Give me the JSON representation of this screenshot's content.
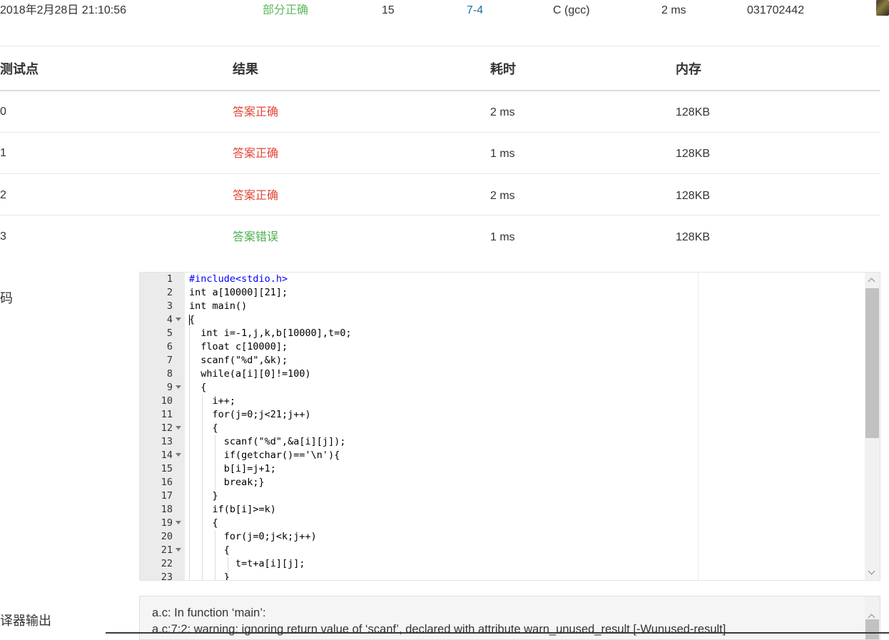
{
  "submission": {
    "time": "2018年2月28日 21:10:56",
    "status": "部分正确",
    "score": "15",
    "problem": "7-4",
    "compiler": "C (gcc)",
    "duration": "2 ms",
    "user": "031702442"
  },
  "test_table": {
    "headers": [
      "测试点",
      "结果",
      "耗时",
      "内存"
    ],
    "rows": [
      {
        "case": "0",
        "result": "答案正确",
        "time": "2 ms",
        "memory": "128KB"
      },
      {
        "case": "1",
        "result": "答案正确",
        "time": "1 ms",
        "memory": "128KB"
      },
      {
        "case": "2",
        "result": "答案正确",
        "time": "2 ms",
        "memory": "128KB"
      },
      {
        "case": "3",
        "result": "答案错误",
        "time": "1 ms",
        "memory": "128KB"
      }
    ]
  },
  "code_section": {
    "label": "码",
    "line_numbers": [
      "1",
      "2",
      "3",
      "4",
      "5",
      "6",
      "7",
      "8",
      "9",
      "10",
      "11",
      "12",
      "13",
      "14",
      "15",
      "16",
      "17",
      "18",
      "19",
      "20",
      "21",
      "22",
      "23"
    ],
    "lines": [
      "#include<stdio.h>",
      "int a[10000][21];",
      "int main()",
      "{",
      "  int i=-1,j,k,b[10000],t=0;",
      "  float c[10000];",
      "  scanf(\"%d\",&k);",
      "  while(a[i][0]!=100)",
      "  {",
      "    i++;",
      "    for(j=0;j<21;j++)",
      "    {",
      "      scanf(\"%d\",&a[i][j]);",
      "      if(getchar()=='\\n'){",
      "      b[i]=j+1;",
      "      break;}",
      "    }",
      "    if(b[i]>=k)",
      "    {",
      "      for(j=0;j<k;j++)",
      "      {",
      "        t=t+a[i][j];",
      "      }"
    ]
  },
  "compile_section": {
    "label": "译器输出",
    "lines": [
      "a.c: In function ‘main’:",
      "a.c:7:2: warning: ignoring return value of ‘scanf’, declared with attribute warn_unused_result [-Wunused-result]"
    ]
  },
  "colors": {
    "status_partial": "#5cb85c",
    "answer_correct": "#e0463a",
    "answer_wrong": "#4cae4c",
    "problem_link": "#1a6fa0"
  },
  "icons": {
    "avatar": "user-avatar",
    "fold": "fold-triangle-icon",
    "scroll_up": "chevron-up-icon",
    "scroll_down": "chevron-down-icon"
  }
}
